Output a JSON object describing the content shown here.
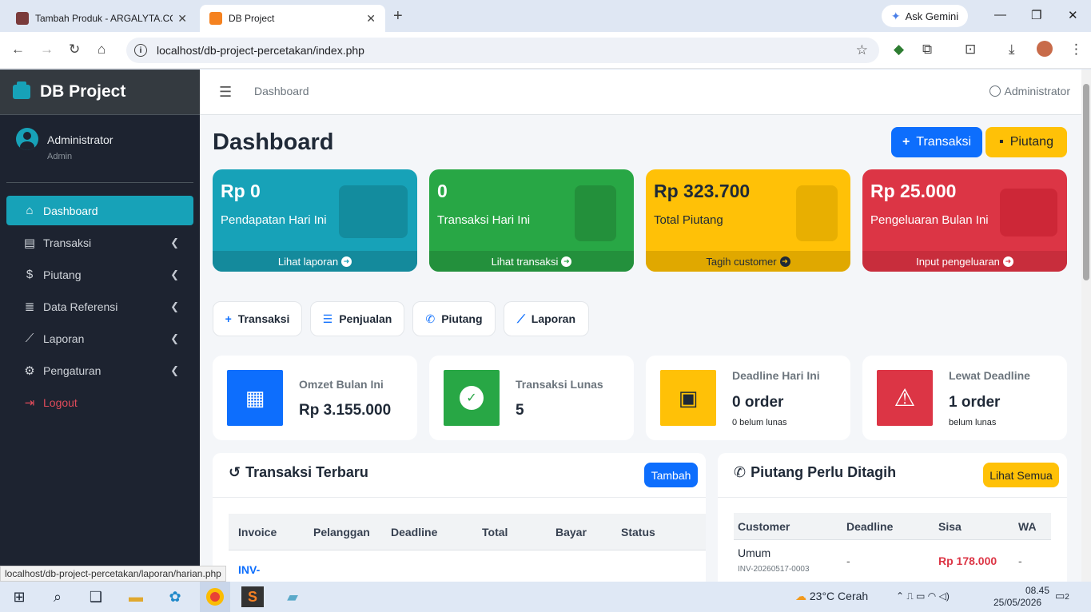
{
  "browser": {
    "tabs": [
      {
        "title": "Tambah Produk - ARGALYTA.CO",
        "active": false
      },
      {
        "title": "DB Project",
        "active": true
      }
    ],
    "gemini_label": "Ask Gemini",
    "url": "localhost/db-project-percetakan/index.php",
    "status_url": "localhost/db-project-percetakan/laporan/harian.php"
  },
  "sidebar": {
    "brand": "DB Project",
    "user": {
      "name": "Administrator",
      "role": "Admin"
    },
    "items": [
      {
        "label": "Dashboard",
        "icon": "home-icon",
        "active": true
      },
      {
        "label": "Transaksi",
        "icon": "cash-register-icon"
      },
      {
        "label": "Piutang",
        "icon": "invoice-dollar-icon"
      },
      {
        "label": "Data Referensi",
        "icon": "database-icon"
      },
      {
        "label": "Laporan",
        "icon": "chart-line-icon"
      },
      {
        "label": "Pengaturan",
        "icon": "gears-icon"
      },
      {
        "label": "Logout",
        "icon": "sign-out-icon"
      }
    ]
  },
  "topnav": {
    "breadcrumb": "Dashboard",
    "user": "Administrator"
  },
  "page": {
    "title": "Dashboard",
    "btn_transaksi": "Transaksi",
    "btn_piutang": "Piutang"
  },
  "stat_boxes": [
    {
      "value": "Rp 0",
      "label": "Pendapatan Hari Ini",
      "link": "Lihat laporan",
      "color": "#17a2b8",
      "foot_color": "#148a9c",
      "icon": "money-bill-icon"
    },
    {
      "value": "0",
      "label": "Transaksi Hari Ini",
      "link": "Lihat transaksi",
      "color": "#28a745",
      "foot_color": "#23903c",
      "icon": "receipt-icon"
    },
    {
      "value": "Rp 323.700",
      "label": "Total Piutang",
      "link": "Tagih customer",
      "color": "#ffc107",
      "foot_color": "#e0a800",
      "icon": "file-dollar-icon"
    },
    {
      "value": "Rp 25.000",
      "label": "Pengeluaran Bulan Ini",
      "link": "Input pengeluaran",
      "color": "#dc3545",
      "foot_color": "#c82d3c",
      "icon": "wallet-icon"
    }
  ],
  "quick_buttons": [
    {
      "label": "Transaksi",
      "icon": "plus-icon"
    },
    {
      "label": "Penjualan",
      "icon": "list-icon"
    },
    {
      "label": "Piutang",
      "icon": "whatsapp-icon"
    },
    {
      "label": "Laporan",
      "icon": "chart-line-icon"
    }
  ],
  "info_boxes": [
    {
      "title": "Omzet Bulan Ini",
      "value": "Rp 3.155.000",
      "sub": "",
      "color": "#0d6efd",
      "icon": "calendar-icon"
    },
    {
      "title": "Transaksi Lunas",
      "value": "5",
      "sub": "",
      "color": "#28a745",
      "icon": "check-circle-icon"
    },
    {
      "title": "Deadline Hari Ini",
      "value": "0 order",
      "sub": "0 belum lunas",
      "color": "#ffc107",
      "icon": "calendar-day-icon"
    },
    {
      "title": "Lewat Deadline",
      "value": "1 order",
      "sub": "belum lunas",
      "color": "#dc3545",
      "icon": "warning-icon"
    }
  ],
  "recent": {
    "title": "Transaksi Terbaru",
    "add_label": "Tambah",
    "columns": [
      "Invoice",
      "Pelanggan",
      "Deadline",
      "Total",
      "Bayar",
      "Status"
    ],
    "first_invoice": "INV-"
  },
  "piutang": {
    "title": "Piutang Perlu Ditagih",
    "see_all": "Lihat Semua",
    "columns": [
      "Customer",
      "Deadline",
      "Sisa",
      "WA"
    ],
    "rows": [
      {
        "customer": "Umum",
        "invoice": "INV-20260517-0003",
        "deadline": "-",
        "sisa": "Rp 178.000",
        "wa": "-"
      }
    ]
  },
  "taskbar": {
    "weather": "23°C  Cerah",
    "time": "08.45",
    "date": "25/05/2026",
    "notif_count": "2"
  }
}
